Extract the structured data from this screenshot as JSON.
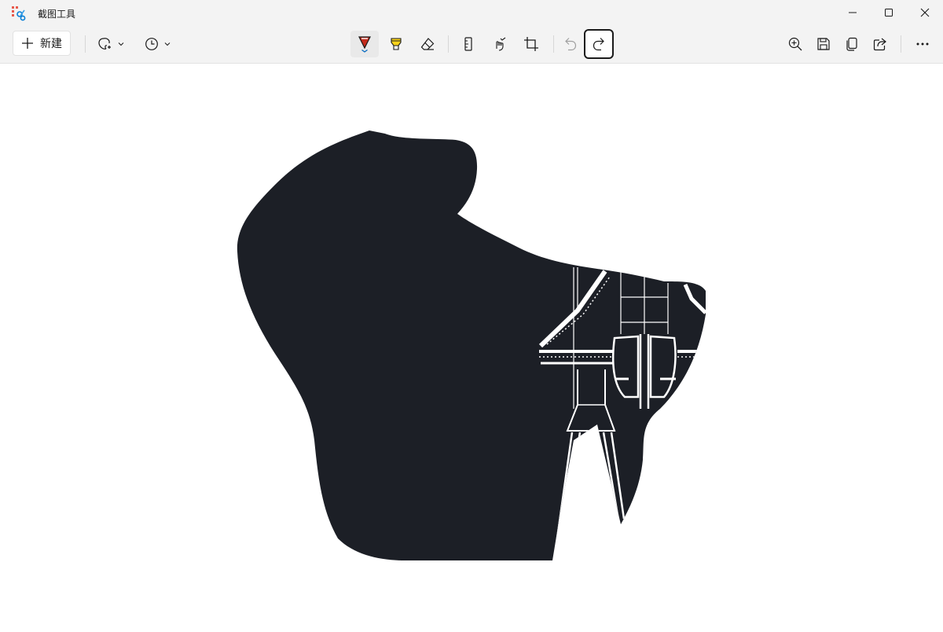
{
  "window": {
    "title": "截图工具"
  },
  "toolbar": {
    "new_label": "新建",
    "icons": {
      "new": "plus-icon",
      "snip_mode": "freeform-snip-icon",
      "delay": "clock-icon",
      "pen": "ballpoint-pen-icon",
      "highlighter": "highlighter-icon",
      "eraser": "eraser-icon",
      "ruler": "ruler-icon",
      "touch_writing": "touch-writing-icon",
      "crop": "crop-icon",
      "undo": "undo-icon",
      "redo": "redo-icon",
      "zoom": "zoom-in-icon",
      "save": "save-icon",
      "copy": "copy-icon",
      "share": "share-icon",
      "more": "more-icon"
    }
  },
  "colors": {
    "chrome_bg": "#f3f3f3",
    "pen_red": "#c42b1c",
    "highlighter_yellow": "#f7d21a",
    "accent_blue": "#0067c0",
    "snip_dark": "#1c1f26"
  }
}
